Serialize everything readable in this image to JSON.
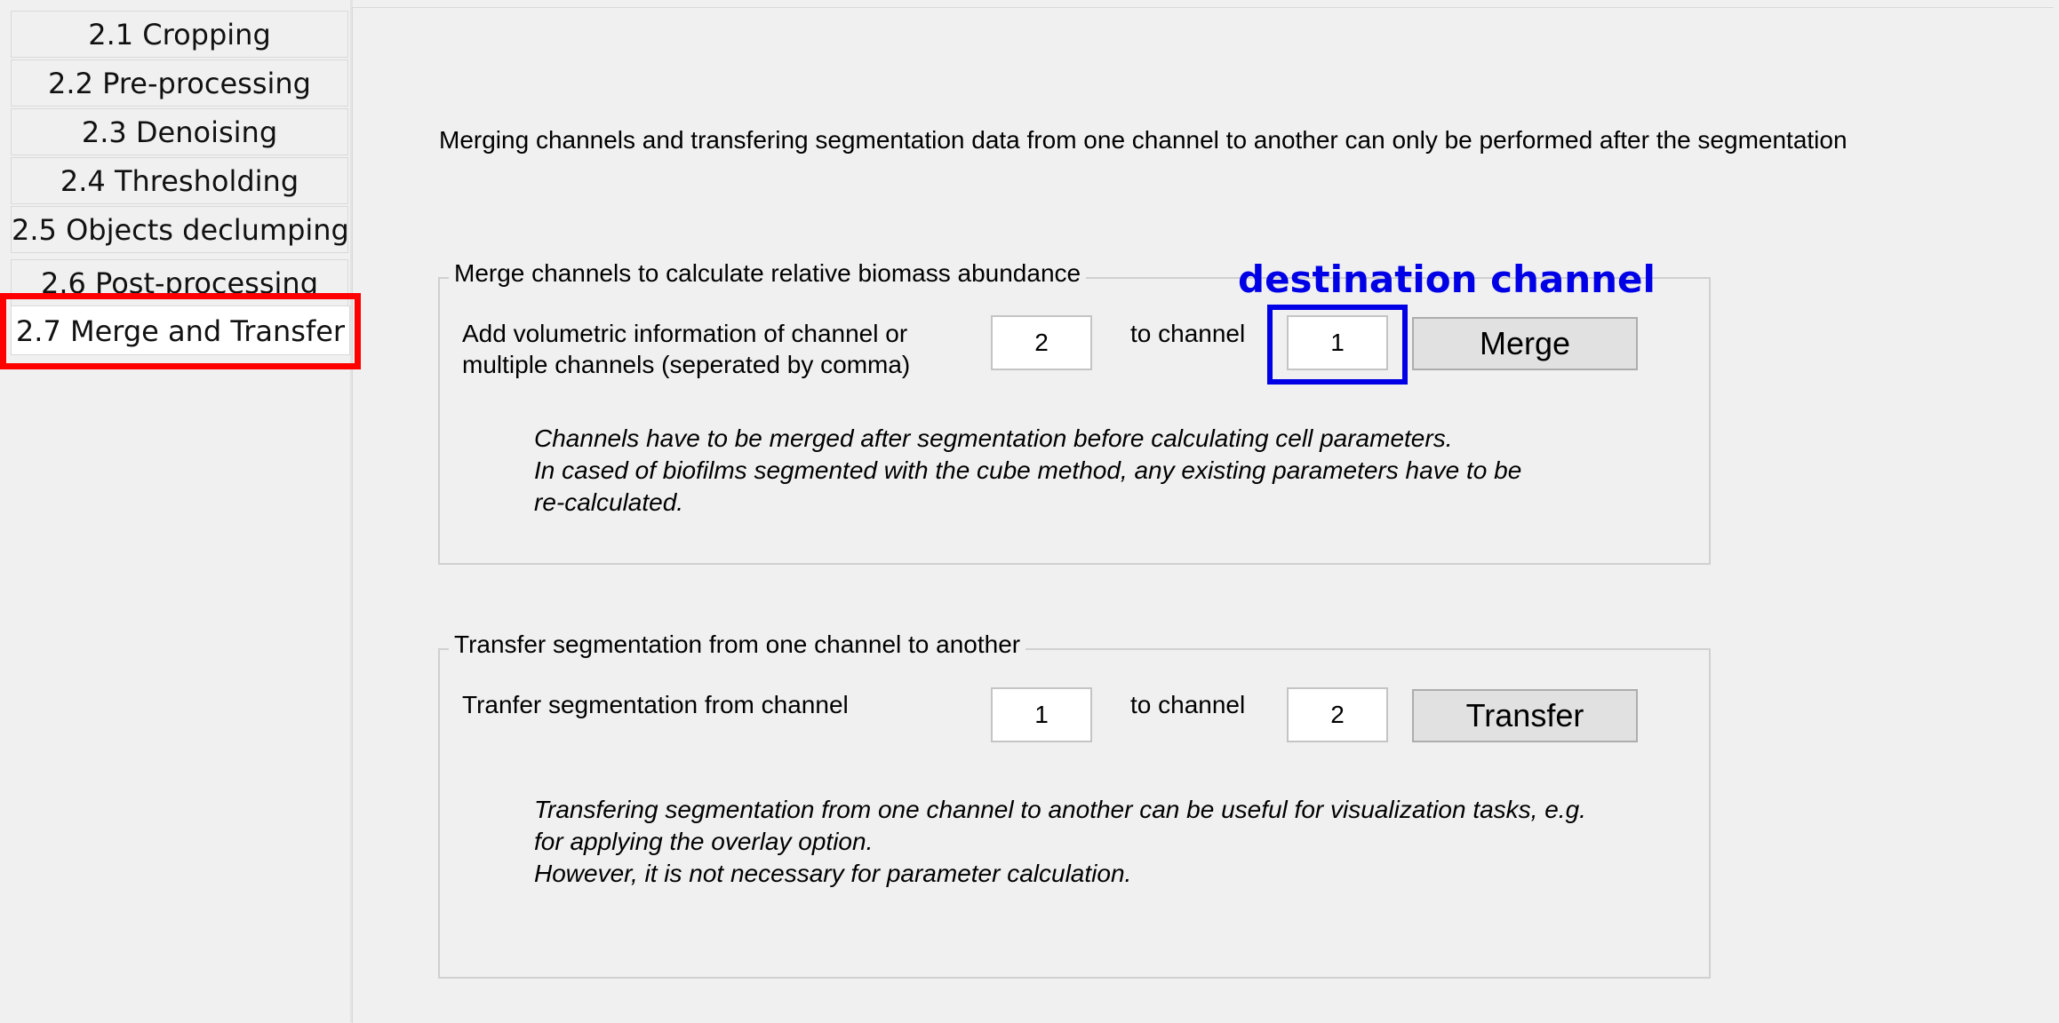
{
  "sidebar": {
    "tabs": [
      {
        "label": "2.1 Cropping"
      },
      {
        "label": "2.2 Pre-processing"
      },
      {
        "label": "2.3 Denoising"
      },
      {
        "label": "2.4 Thresholding"
      },
      {
        "label": "2.5 Objects declumping"
      },
      {
        "label": "2.6 Post-processing"
      },
      {
        "label": "2.7 Merge and Transfer"
      }
    ],
    "active_index": 6
  },
  "main": {
    "info_text": "Merging channels and transfering segmentation data from one channel to another can only be performed after the segmentation",
    "merge_group": {
      "title": "Merge channels to calculate relative biomass abundance",
      "source_label_line1": "Add volumetric information of channel or",
      "source_label_line2": "multiple channels (seperated by comma)",
      "source_value": "2",
      "to_label": "to channel",
      "dest_value": "1",
      "button_label": "Merge",
      "note_line1": "Channels have to be merged after segmentation before calculating cell parameters.",
      "note_line2": "In cased of biofilms segmented with the cube method, any existing parameters have to be",
      "note_line3": "re-calculated."
    },
    "transfer_group": {
      "title": "Transfer segmentation from one channel to another",
      "source_label": "Tranfer segmentation from channel",
      "source_value": "1",
      "to_label": "to channel",
      "dest_value": "2",
      "button_label": "Transfer",
      "note_line1": "Transfering segmentation from one channel to another can be useful for visualization tasks, e.g.",
      "note_line2": "for applying the overlay option.",
      "note_line3": "However, it is not necessary for parameter calculation."
    }
  },
  "annotations": {
    "callout_text": "destination channel",
    "callout_color": "#0000e6",
    "highlight_color": "#ff0000"
  }
}
